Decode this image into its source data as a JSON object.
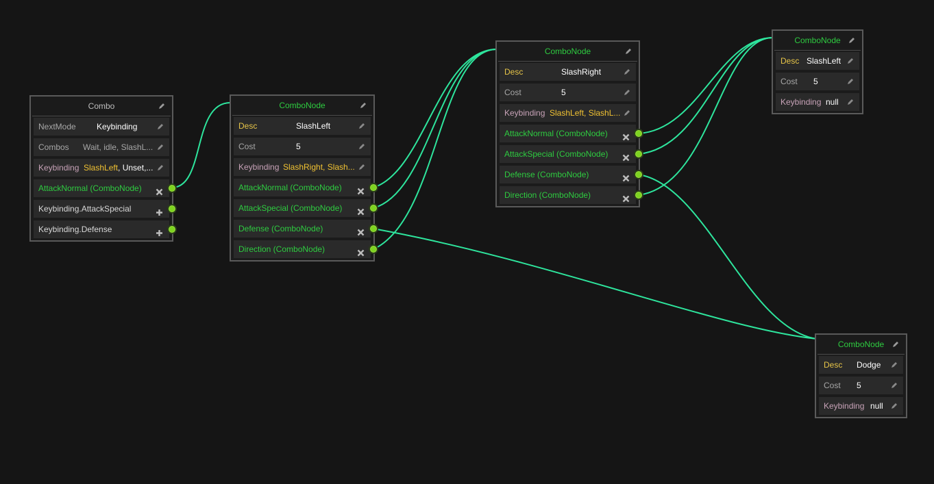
{
  "colors": {
    "background": "#151515",
    "wire": "#2ee59d",
    "port": "#7ed321",
    "node_title_green": "#2ecc40",
    "label_yellow": "#e7c548",
    "label_pink": "#c8a3b8",
    "value_yellow": "#f1c232"
  },
  "nodes": {
    "combo": {
      "title": "Combo",
      "rows": [
        {
          "label": "NextMode",
          "value": "Keybinding"
        },
        {
          "label": "Combos",
          "value": "Wait, idle, SlashL..."
        },
        {
          "label": "Keybinding",
          "value_a": "SlashLeft",
          "value_b": ", Unset,..."
        },
        {
          "label": "AttackNormal (ComboNode)"
        },
        {
          "label": "Keybinding.AttackSpecial"
        },
        {
          "label": "Keybinding.Defense"
        }
      ]
    },
    "node1": {
      "title": "ComboNode",
      "rows": [
        {
          "label": "Desc",
          "value": "SlashLeft"
        },
        {
          "label": "Cost",
          "value": "5"
        },
        {
          "label": "Keybinding",
          "value": "SlashRight, Slash..."
        },
        {
          "label": "AttackNormal (ComboNode)"
        },
        {
          "label": "AttackSpecial (ComboNode)"
        },
        {
          "label": "Defense (ComboNode)"
        },
        {
          "label": "Direction (ComboNode)"
        }
      ]
    },
    "node2": {
      "title": "ComboNode",
      "rows": [
        {
          "label": "Desc",
          "value": "SlashRight"
        },
        {
          "label": "Cost",
          "value": "5"
        },
        {
          "label": "Keybinding",
          "value": "SlashLeft, SlashL..."
        },
        {
          "label": "AttackNormal (ComboNode)"
        },
        {
          "label": "AttackSpecial (ComboNode)"
        },
        {
          "label": "Defense (ComboNode)"
        },
        {
          "label": "Direction (ComboNode)"
        }
      ]
    },
    "node3": {
      "title": "ComboNode",
      "rows": [
        {
          "label": "Desc",
          "value": "SlashLeft"
        },
        {
          "label": "Cost",
          "value": "5"
        },
        {
          "label": "Keybinding",
          "value": "null"
        }
      ]
    },
    "node4": {
      "title": "ComboNode",
      "rows": [
        {
          "label": "Desc",
          "value": "Dodge"
        },
        {
          "label": "Cost",
          "value": "5"
        },
        {
          "label": "Keybinding",
          "value": "null"
        }
      ]
    }
  }
}
